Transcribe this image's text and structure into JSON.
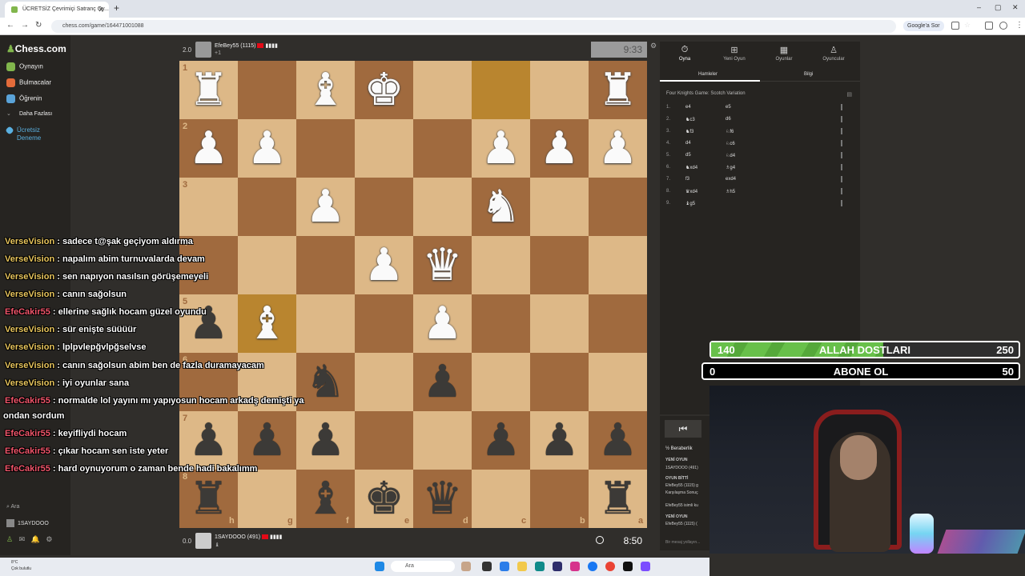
{
  "browser": {
    "tab_title": "ÜCRETSİZ Çevrimiçi Satranç Oy...",
    "url": "chess.com/game/164471001088",
    "google_label": "Google'a Sor"
  },
  "sidebar": {
    "logo": "Chess.com",
    "items": [
      {
        "label": "Oynayın",
        "color": "#81b64c"
      },
      {
        "label": "Bulmacalar",
        "color": "#e36b3a"
      },
      {
        "label": "Öğrenin",
        "color": "#5aa3d8"
      },
      {
        "label": "Daha Fazlası",
        "color": "#888888"
      },
      {
        "label": "Ücretsiz Deneme",
        "color": "#5ab0e0"
      }
    ],
    "search": "Ara",
    "username": "1SAYDOOO"
  },
  "players": {
    "top": {
      "score": "2.0",
      "name": "EfeBey55 (1115)",
      "captured": "+1",
      "clock": "9:33"
    },
    "bottom": {
      "score": "0.0",
      "name": "1SAYDOOO (491)",
      "clock": "8:50"
    }
  },
  "board": {
    "ranks_label": [
      "1",
      "2",
      "3",
      "4",
      "5",
      "6",
      "7",
      "8"
    ],
    "files_label": [
      "h",
      "g",
      "f",
      "e",
      "d",
      "c",
      "b",
      "a"
    ],
    "highlights": [
      [
        0,
        5
      ],
      [
        4,
        1
      ]
    ],
    "pieces": [
      [
        0,
        0,
        "wR"
      ],
      [
        0,
        2,
        "wB"
      ],
      [
        0,
        3,
        "wK"
      ],
      [
        0,
        7,
        "wR"
      ],
      [
        1,
        0,
        "wP"
      ],
      [
        1,
        1,
        "wP"
      ],
      [
        1,
        5,
        "wP"
      ],
      [
        1,
        6,
        "wP"
      ],
      [
        1,
        7,
        "wP"
      ],
      [
        2,
        2,
        "wP"
      ],
      [
        2,
        5,
        "wN"
      ],
      [
        3,
        3,
        "wP"
      ],
      [
        3,
        4,
        "wQ"
      ],
      [
        4,
        0,
        "bP"
      ],
      [
        4,
        1,
        "wB"
      ],
      [
        4,
        4,
        "wP"
      ],
      [
        5,
        2,
        "bN"
      ],
      [
        5,
        4,
        "bP"
      ],
      [
        6,
        0,
        "bP"
      ],
      [
        6,
        1,
        "bP"
      ],
      [
        6,
        2,
        "bP"
      ],
      [
        6,
        5,
        "bP"
      ],
      [
        6,
        6,
        "bP"
      ],
      [
        6,
        7,
        "bP"
      ],
      [
        7,
        0,
        "bR"
      ],
      [
        7,
        2,
        "bB"
      ],
      [
        7,
        3,
        "bK"
      ],
      [
        7,
        4,
        "bQ"
      ],
      [
        7,
        7,
        "bR"
      ]
    ]
  },
  "right_panel": {
    "tabs": [
      "Oyna",
      "Yeni Oyun",
      "Oyunlar",
      "Oyuncular"
    ],
    "subtabs": [
      "Hamleler",
      "Bilgi"
    ],
    "opening": "Four Knights Game: Scotch Variation",
    "moves": [
      {
        "n": "1.",
        "w": "e4",
        "b": "e5"
      },
      {
        "n": "2.",
        "w": "♞c3",
        "b": "d6"
      },
      {
        "n": "3.",
        "w": "♞f3",
        "b": "♘f6"
      },
      {
        "n": "4.",
        "w": "d4",
        "b": "♘c6"
      },
      {
        "n": "5.",
        "w": "d5",
        "b": "♘d4"
      },
      {
        "n": "6.",
        "w": "♞xd4",
        "b": "♗g4"
      },
      {
        "n": "7.",
        "w": "f3",
        "b": "exd4"
      },
      {
        "n": "8.",
        "w": "♛xd4",
        "b": "♗h5"
      },
      {
        "n": "9.",
        "w": "♝g5",
        "b": ""
      }
    ]
  },
  "goals": {
    "follow": {
      "current": "140",
      "label": "ALLAH DOSTLARI",
      "target": "250",
      "progress": 0.56
    },
    "subscribe": {
      "current": "0",
      "label": "ABONE OL",
      "target": "50"
    }
  },
  "game_chat": [
    "½ Beraberlik",
    "YENİ OYUN",
    "1SAYDOOO (491)",
    "OYUN BİTTİ",
    "EfeBey55 (1115) g",
    "Karşılaşma Sonuç",
    "EfeBey55 isimli ku",
    "YENİ OYUN",
    "EfeBey55 (1115) (",
    "Bir mesaj yollayın..."
  ],
  "stream_chat": [
    {
      "user": "VerseVision",
      "msg": " : sadece t@şak geçiyom aldırma",
      "type": 1
    },
    {
      "user": "VerseVision",
      "msg": " : napalım abim turnuvalarda devam",
      "type": 1
    },
    {
      "user": "VerseVision",
      "msg": " : sen napıyon nasılsın görüşemeyeli",
      "type": 1
    },
    {
      "user": "VerseVision",
      "msg": " : canın sağolsun",
      "type": 1
    },
    {
      "user": "EfeCakir55",
      "msg": " : ellerine sağlık hocam güzel oyundu",
      "type": 2
    },
    {
      "user": "VerseVision",
      "msg": " : sür enişte süüüür",
      "type": 1
    },
    {
      "user": "VerseVision",
      "msg": " : lplpvlepğvlpğselvse",
      "type": 1
    },
    {
      "user": "VerseVision",
      "msg": " : canın sağolsun abim ben de fazla duramayacam",
      "type": 1
    },
    {
      "user": "VerseVision",
      "msg": " : iyi oyunlar sana",
      "type": 1
    },
    {
      "user": "EfeCakir55",
      "msg": " : normalde lol yayını mı yapıyosun hocam arkadş demişti ya",
      "type": 2
    },
    {
      "user": "",
      "msg": "ondan sordum",
      "type": 0
    },
    {
      "user": "EfeCakir55",
      "msg": " : keyifliydi hocam",
      "type": 2
    },
    {
      "user": "EfeCakir55",
      "msg": " : çıkar hocam sen iste yeter",
      "type": 2
    },
    {
      "user": "EfeCakir55",
      "msg": " : hard oynuyorum o zaman bende hadi bakalımm",
      "type": 2
    }
  ],
  "taskbar": {
    "weather_temp": "8°C",
    "weather_desc": "Çok bulutlu",
    "search": "Ara"
  }
}
